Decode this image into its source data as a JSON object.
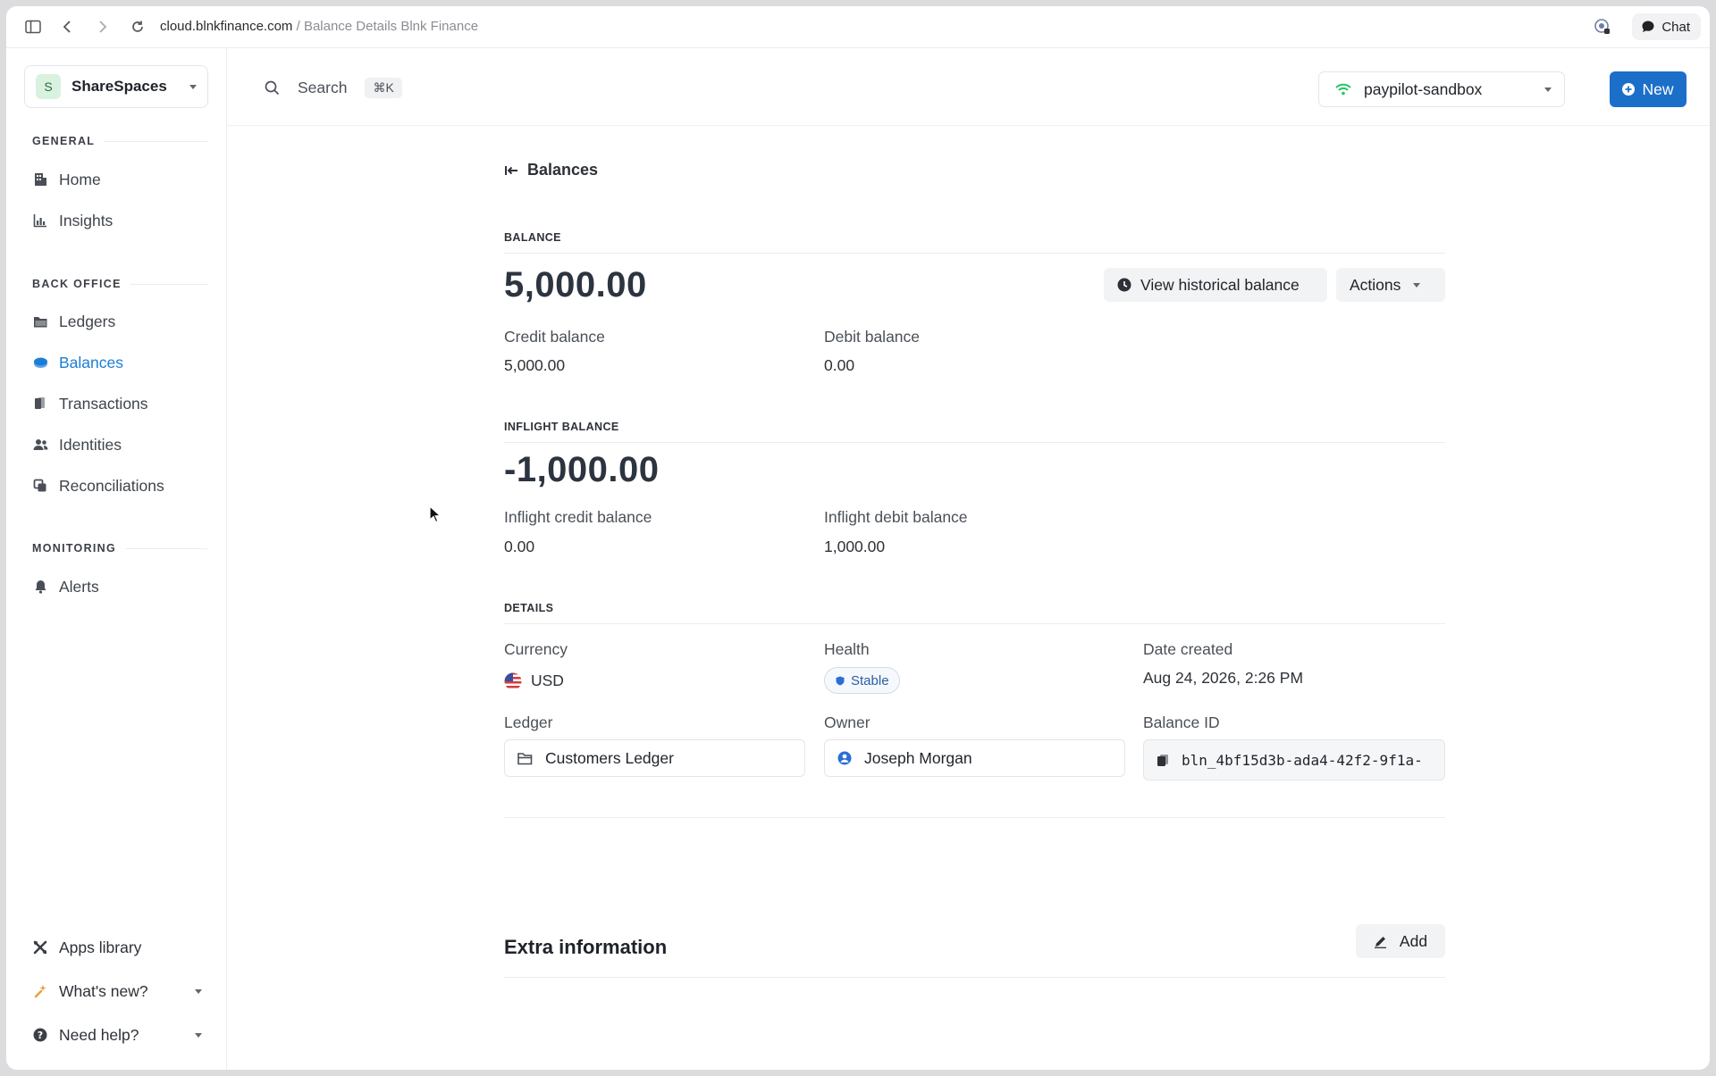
{
  "browser": {
    "url_host": "cloud.blnkfinance.com",
    "url_sep": " / ",
    "url_title": "Balance Details Blnk Finance",
    "chat_label": "Chat"
  },
  "sidebar": {
    "workspace_initial": "S",
    "workspace_name": "ShareSpaces",
    "general_label": "GENERAL",
    "general_items": [
      {
        "label": "Home",
        "icon": "home-icon"
      },
      {
        "label": "Insights",
        "icon": "chart-icon"
      }
    ],
    "backoffice_label": "BACK OFFICE",
    "backoffice_items": [
      {
        "label": "Ledgers",
        "icon": "folder-icon"
      },
      {
        "label": "Balances",
        "icon": "coins-icon"
      },
      {
        "label": "Transactions",
        "icon": "transactions-icon"
      },
      {
        "label": "Identities",
        "icon": "users-icon"
      },
      {
        "label": "Reconciliations",
        "icon": "reconcile-icon"
      }
    ],
    "monitoring_label": "MONITORING",
    "monitoring_items": [
      {
        "label": "Alerts",
        "icon": "bell-icon"
      }
    ],
    "apps_library": "Apps library",
    "whats_new": "What's new?",
    "need_help": "Need help?"
  },
  "topbar": {
    "search_label": "Search",
    "search_shortcut": "⌘K",
    "environment": "paypilot-sandbox",
    "new_label": "New"
  },
  "main": {
    "back_label": "Balances",
    "balance_section": "BALANCE",
    "balance": "5,000.00",
    "view_historical": "View historical balance",
    "actions": "Actions",
    "credit_label": "Credit balance",
    "credit_value": "5,000.00",
    "debit_label": "Debit balance",
    "debit_value": "0.00",
    "inflight_section": "INFLIGHT BALANCE",
    "inflight_balance": "-1,000.00",
    "inflight_credit_label": "Inflight credit balance",
    "inflight_credit_value": "0.00",
    "inflight_debit_label": "Inflight debit balance",
    "inflight_debit_value": "1,000.00",
    "details_section": "DETAILS",
    "currency_label": "Currency",
    "currency_value": "USD",
    "health_label": "Health",
    "health_value": "Stable",
    "date_label": "Date created",
    "date_value": "Aug 24, 2026, 2:26 PM",
    "ledger_label": "Ledger",
    "ledger_value": "Customers Ledger",
    "owner_label": "Owner",
    "owner_value": "Joseph Morgan",
    "balance_id_label": "Balance ID",
    "balance_id_value": "bln_4bf15d3b-ada4-42f2-9f1a-",
    "extra_title": "Extra information",
    "add_label": "Add"
  },
  "colors": {
    "accent": "#1c6fc9",
    "active_nav": "#1c7ed6",
    "status_online": "#22c55e"
  }
}
